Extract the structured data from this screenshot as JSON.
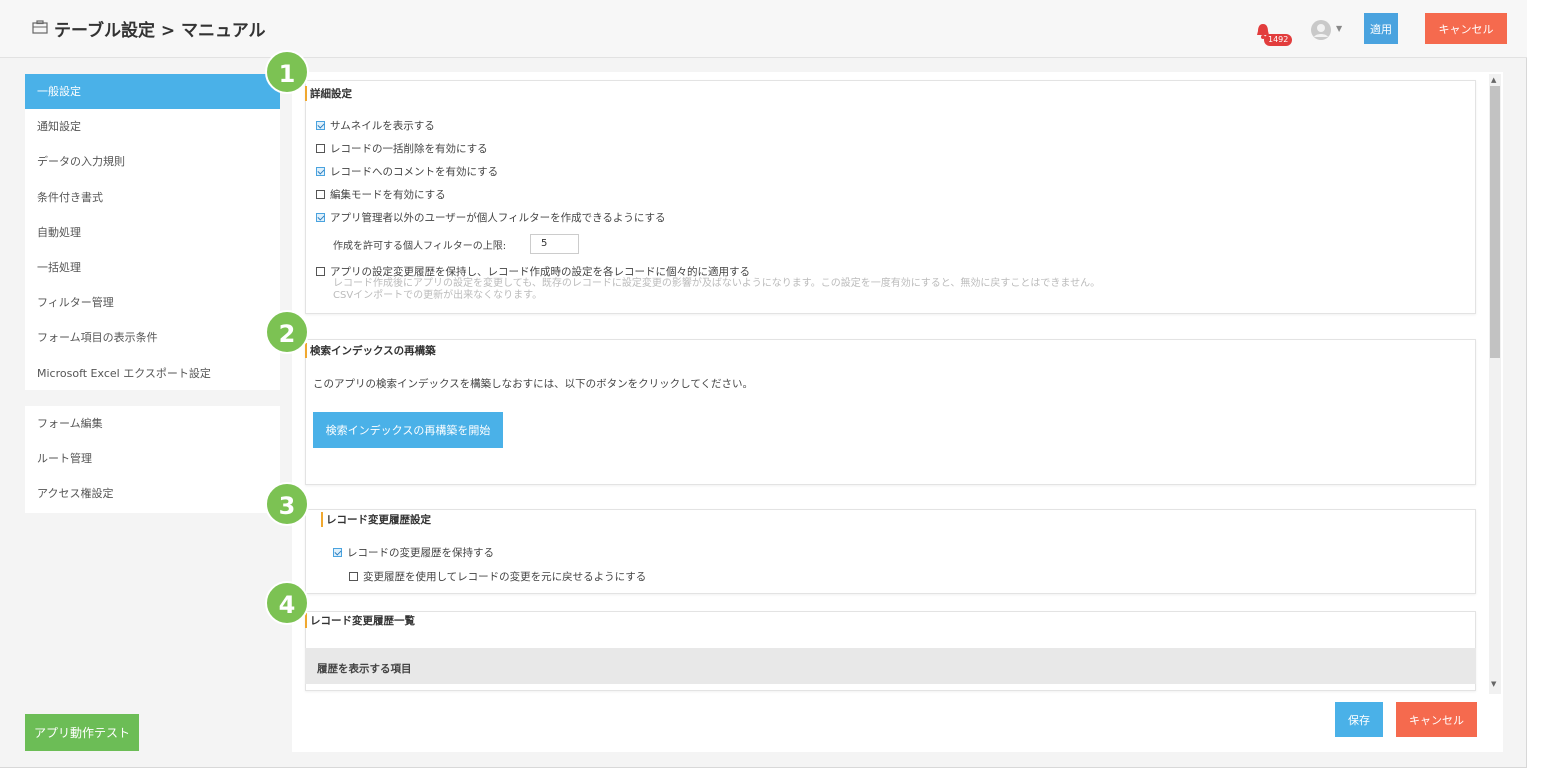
{
  "header": {
    "title": "テーブル設定 > マニュアル",
    "notification_count": "1492",
    "apply_label": "適用",
    "cancel_label": "キャンセル"
  },
  "sidebar": {
    "group1": [
      {
        "label": "一般設定",
        "active": true
      },
      {
        "label": "通知設定"
      },
      {
        "label": "データの入力規則"
      },
      {
        "label": "条件付き書式"
      },
      {
        "label": "自動処理"
      },
      {
        "label": "一括処理"
      },
      {
        "label": "フィルター管理"
      },
      {
        "label": "フォーム項目の表示条件"
      },
      {
        "label": "Microsoft Excel エクスポート設定"
      }
    ],
    "group2": [
      {
        "label": "フォーム編集"
      },
      {
        "label": "ルート管理"
      },
      {
        "label": "アクセス権設定"
      }
    ],
    "test_button_label": "アプリ動作テスト"
  },
  "sections": {
    "detail": {
      "title": "詳細設定",
      "options": [
        {
          "label": "サムネイルを表示する",
          "checked": true
        },
        {
          "label": "レコードの一括削除を有効にする",
          "checked": false
        },
        {
          "label": "レコードへのコメントを有効にする",
          "checked": true
        },
        {
          "label": "編集モードを有効にする",
          "checked": false
        },
        {
          "label": "アプリ管理者以外のユーザーが個人フィルターを作成できるようにする",
          "checked": true
        }
      ],
      "filter_limit_label": "作成を許可する個人フィルターの上限:",
      "filter_limit_value": "5",
      "history_option": {
        "label": "アプリの設定変更履歴を保持し、レコード作成時の設定を各レコードに個々的に適用する",
        "checked": false
      },
      "history_note_line1": "レコード作成後にアプリの設定を変更しても、既存のレコードに設定変更の影響が及ばないようになります。この設定を一度有効にすると、無効に戻すことはできません。",
      "history_note_line2": "CSVインポートでの更新が出来なくなります。"
    },
    "rebuild": {
      "title": "検索インデックスの再構築",
      "description": "このアプリの検索インデックスを構築しなおすには、以下のボタンをクリックしてください。",
      "button_label": "検索インデックスの再構築を開始"
    },
    "record_history": {
      "title": "レコード変更履歴設定",
      "keep_label": "レコードの変更履歴を保持する",
      "keep_checked": true,
      "revert_label": "変更履歴を使用してレコードの変更を元に戻せるようにする",
      "revert_checked": false
    },
    "history_list": {
      "title": "レコード変更履歴一覧",
      "column_header": "履歴を表示する項目"
    }
  },
  "footer": {
    "save_label": "保存",
    "cancel_label": "キャンセル"
  },
  "markers": [
    "1",
    "2",
    "3",
    "4"
  ],
  "colors": {
    "accent_blue": "#4ab1e8",
    "cancel_red": "#f56a4e",
    "test_green": "#6cbd56",
    "marker_green": "#7cc253",
    "title_bar": "#f0a830"
  }
}
